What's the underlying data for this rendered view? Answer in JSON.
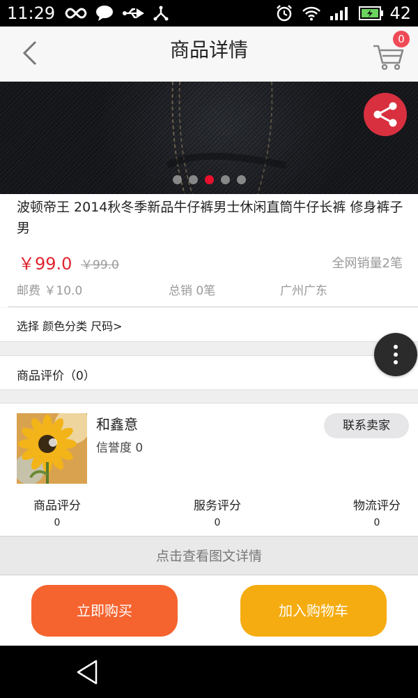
{
  "status_bar": {
    "time": "11:29",
    "battery_level": "42",
    "icons": [
      "infinity-icon",
      "message-icon",
      "usb-icon",
      "share-tree-icon",
      "alarm-icon",
      "wifi-icon",
      "signal-icon",
      "battery-icon"
    ]
  },
  "header": {
    "title": "商品详情",
    "cart_badge": "0"
  },
  "gallery": {
    "dot_count": 5,
    "active_dot": 3
  },
  "product": {
    "name": "波顿帝王 2014秋冬季新品牛仔裤男士休闲直筒牛仔长裤 修身裤子男",
    "price": "￥99.0",
    "original_price": "￥99.0",
    "sales_all": "全网销量2笔",
    "postage": "邮费 ￥10.0",
    "total_sales": "总销 0笔",
    "location": "广州广东"
  },
  "select_options": "选择 颜色分类 尺码>",
  "reviews_label": "商品评价（0）",
  "shop": {
    "name": "和鑫意",
    "credit": "信誉度 0",
    "contact_label": "联系卖家",
    "ratings": [
      {
        "label": "商品评分",
        "value": "0"
      },
      {
        "label": "服务评分",
        "value": "0"
      },
      {
        "label": "物流评分",
        "value": "0"
      }
    ]
  },
  "detail_link": "点击查看图文详情",
  "actions": {
    "buy_label": "立即购买",
    "add_cart_label": "加入购物车"
  },
  "colors": {
    "accent_red": "#e0242f",
    "buy_button": "#f5642f",
    "cart_button": "#f5ac10",
    "share_button": "#d8303f"
  }
}
